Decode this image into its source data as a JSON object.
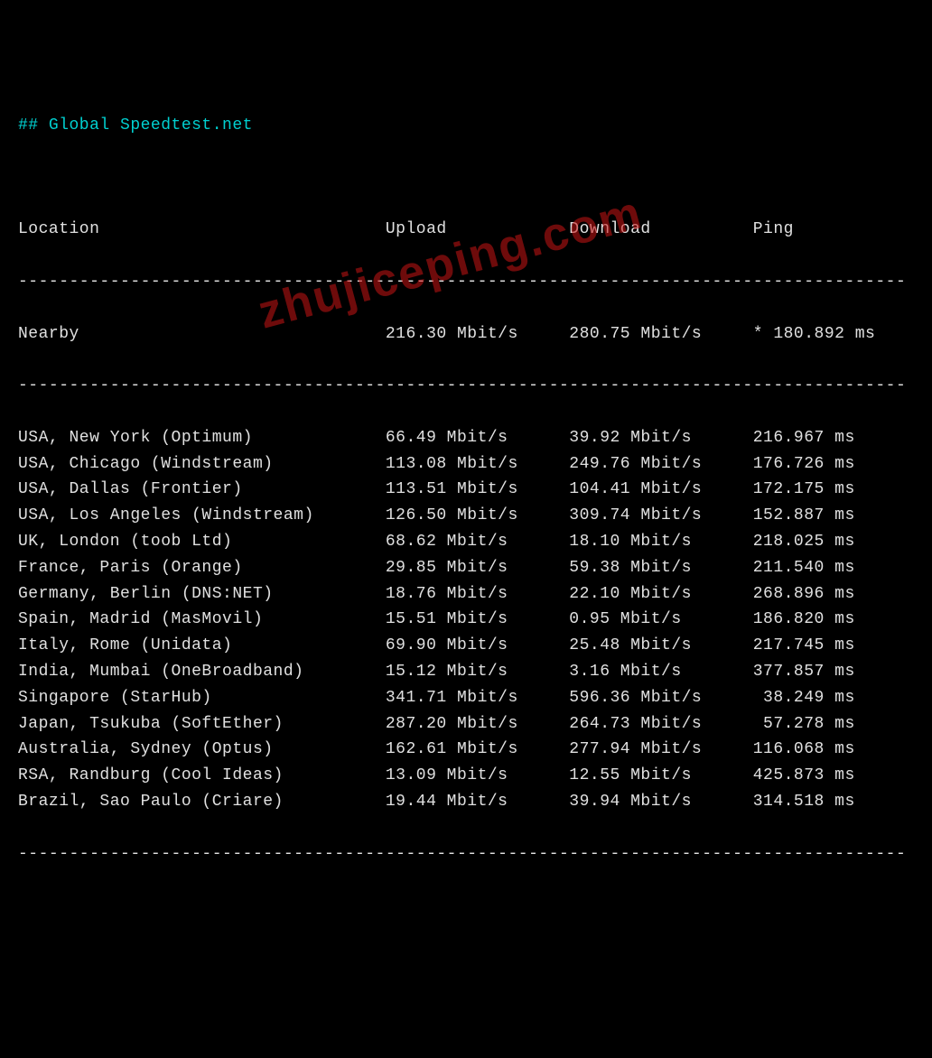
{
  "title": "## Global Speedtest.net",
  "headers": {
    "location": "Location",
    "upload": "Upload",
    "download": "Download",
    "ping": "Ping"
  },
  "separator": "---------------------------------------------------------------------------------------",
  "nearby": {
    "location": "Nearby",
    "upload": "216.30 Mbit/s",
    "download": "280.75 Mbit/s",
    "ping": "* 180.892 ms"
  },
  "rows": [
    {
      "location": "USA, New York (Optimum)",
      "upload": "66.49 Mbit/s",
      "download": "39.92 Mbit/s",
      "ping": "216.967 ms"
    },
    {
      "location": "USA, Chicago (Windstream)",
      "upload": "113.08 Mbit/s",
      "download": "249.76 Mbit/s",
      "ping": "176.726 ms"
    },
    {
      "location": "USA, Dallas (Frontier)",
      "upload": "113.51 Mbit/s",
      "download": "104.41 Mbit/s",
      "ping": "172.175 ms"
    },
    {
      "location": "USA, Los Angeles (Windstream)",
      "upload": "126.50 Mbit/s",
      "download": "309.74 Mbit/s",
      "ping": "152.887 ms"
    },
    {
      "location": "UK, London (toob Ltd)",
      "upload": "68.62 Mbit/s",
      "download": "18.10 Mbit/s",
      "ping": "218.025 ms"
    },
    {
      "location": "France, Paris (Orange)",
      "upload": "29.85 Mbit/s",
      "download": "59.38 Mbit/s",
      "ping": "211.540 ms"
    },
    {
      "location": "Germany, Berlin (DNS:NET)",
      "upload": "18.76 Mbit/s",
      "download": "22.10 Mbit/s",
      "ping": "268.896 ms"
    },
    {
      "location": "Spain, Madrid (MasMovil)",
      "upload": "15.51 Mbit/s",
      "download": "0.95 Mbit/s",
      "ping": "186.820 ms"
    },
    {
      "location": "Italy, Rome (Unidata)",
      "upload": "69.90 Mbit/s",
      "download": "25.48 Mbit/s",
      "ping": "217.745 ms"
    },
    {
      "location": "India, Mumbai (OneBroadband)",
      "upload": "15.12 Mbit/s",
      "download": "3.16 Mbit/s",
      "ping": "377.857 ms"
    },
    {
      "location": "Singapore (StarHub)",
      "upload": "341.71 Mbit/s",
      "download": "596.36 Mbit/s",
      "ping": " 38.249 ms"
    },
    {
      "location": "Japan, Tsukuba (SoftEther)",
      "upload": "287.20 Mbit/s",
      "download": "264.73 Mbit/s",
      "ping": " 57.278 ms"
    },
    {
      "location": "Australia, Sydney (Optus)",
      "upload": "162.61 Mbit/s",
      "download": "277.94 Mbit/s",
      "ping": "116.068 ms"
    },
    {
      "location": "RSA, Randburg (Cool Ideas)",
      "upload": "13.09 Mbit/s",
      "download": "12.55 Mbit/s",
      "ping": "425.873 ms"
    },
    {
      "location": "Brazil, Sao Paulo (Criare)",
      "upload": "19.44 Mbit/s",
      "download": "39.94 Mbit/s",
      "ping": "314.518 ms"
    }
  ],
  "watermark": "zhujiceping.com"
}
